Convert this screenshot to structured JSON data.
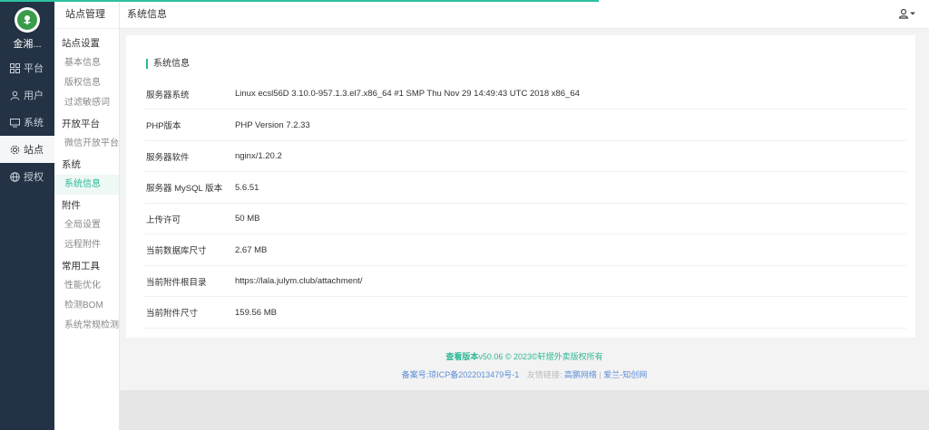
{
  "app": {
    "site_name": "金湘...",
    "brand_color": "#2cb896",
    "nav_bg": "#233244"
  },
  "leftnav": [
    {
      "label": "平台",
      "icon": "grid-icon",
      "active": false
    },
    {
      "label": "用户",
      "icon": "user-icon",
      "active": false
    },
    {
      "label": "系统",
      "icon": "monitor-icon",
      "active": false
    },
    {
      "label": "站点",
      "icon": "gear-icon",
      "active": true
    },
    {
      "label": "授权",
      "icon": "globe-icon",
      "active": false
    }
  ],
  "subnav": {
    "header": "站点管理",
    "groups": [
      {
        "title": "站点设置",
        "items": [
          "基本信息",
          "版权信息",
          "过滤敏感词"
        ]
      },
      {
        "title": "开放平台",
        "items": [
          "微信开放平台"
        ]
      },
      {
        "title": "系统",
        "items": [
          "系统信息"
        ]
      },
      {
        "title": "附件",
        "items": [
          "全局设置",
          "远程附件"
        ]
      },
      {
        "title": "常用工具",
        "items": [
          "性能优化",
          "检测BOM",
          "系统常规检测"
        ]
      }
    ],
    "active_item": "系统信息"
  },
  "header": {
    "title": "系统信息"
  },
  "panel": {
    "title": "系统信息",
    "rows": [
      {
        "key": "服务器系统",
        "value": "Linux ecsl56D 3.10.0-957.1.3.el7.x86_64 #1 SMP Thu Nov 29 14:49:43 UTC 2018 x86_64"
      },
      {
        "key": "PHP版本",
        "value": "PHP Version 7.2.33"
      },
      {
        "key": "服务器软件",
        "value": "nginx/1.20.2"
      },
      {
        "key": "服务器 MySQL 版本",
        "value": "5.6.51"
      },
      {
        "key": "上传许可",
        "value": "50 MB"
      },
      {
        "key": "当前数据库尺寸",
        "value": "2.67 MB"
      },
      {
        "key": "当前附件根目录",
        "value": "https://lala.julym.club/attachment/"
      },
      {
        "key": "当前附件尺寸",
        "value": "159.56 MB"
      }
    ]
  },
  "footer": {
    "version_label": "查看版本",
    "version_text": "v50.06 © 2023©轩熤外卖版权所有",
    "icp": "备案号:琼ICP备2022013479号-1",
    "links_label": "友情链接:",
    "link1": "高鹏网络",
    "separator": "|",
    "link2": "爱兰-知创网"
  }
}
